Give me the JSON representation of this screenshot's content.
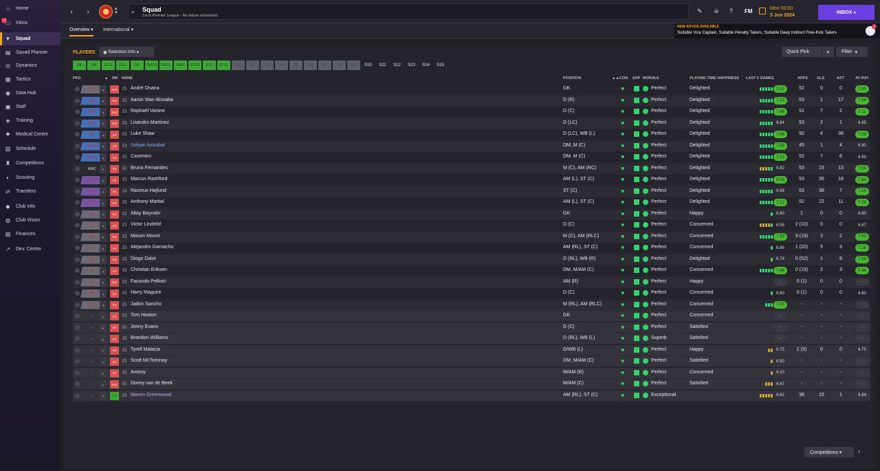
{
  "sidebar": {
    "inbox_badge": "13",
    "items": [
      {
        "label": "Home",
        "icon": "home-icon",
        "glyph": "⌂"
      },
      {
        "label": "Inbox",
        "icon": "inbox-icon",
        "glyph": "▭"
      },
      {
        "label": "Squad",
        "icon": "shirt-icon",
        "glyph": "▼",
        "active": true
      },
      {
        "label": "Squad Planner",
        "icon": "planner-icon",
        "glyph": "▤"
      },
      {
        "label": "Dynamics",
        "icon": "dynamics-icon",
        "glyph": "◎"
      },
      {
        "label": "Tactics",
        "icon": "tactics-icon",
        "glyph": "▦"
      },
      {
        "label": "Data Hub",
        "icon": "data-hub-icon",
        "glyph": "◉"
      },
      {
        "label": "Staff",
        "icon": "staff-icon",
        "glyph": "▣"
      },
      {
        "label": "Training",
        "icon": "training-icon",
        "glyph": "◈"
      },
      {
        "label": "Medical Centre",
        "icon": "medical-icon",
        "glyph": "✚"
      },
      {
        "label": "Schedule",
        "icon": "schedule-icon",
        "glyph": "▥"
      },
      {
        "label": "Competitions",
        "icon": "trophy-icon",
        "glyph": "♜"
      },
      {
        "label": "Scouting",
        "icon": "scouting-icon",
        "glyph": "◐"
      },
      {
        "label": "Transfers",
        "icon": "transfers-icon",
        "glyph": "⇄"
      },
      {
        "label": "Club Info",
        "icon": "shield-icon",
        "glyph": "◆"
      },
      {
        "label": "Club Vision",
        "icon": "vision-icon",
        "glyph": "◍"
      },
      {
        "label": "Finances",
        "icon": "finances-icon",
        "glyph": "▧"
      },
      {
        "label": "Dev. Centre",
        "icon": "dev-centre-icon",
        "glyph": "↗"
      }
    ]
  },
  "header": {
    "title": "Squad",
    "subtitle": "1st in Premier League - No fixture scheduled.",
    "fm": "FM",
    "time": "Mon 00:00",
    "date": "3 Jun 2024",
    "inbox_btn": "INBOX  »"
  },
  "tabs": [
    {
      "label": "Overview ▾"
    },
    {
      "label": "International ▾"
    }
  ],
  "advice": {
    "title": "NEW ADVICE AVAILABLE",
    "text": "Suitable Vice Captain, Suitable Penalty Takers, Suitable Deep Indirect Free-Kick Takers",
    "badge": "3"
  },
  "toolbar": {
    "players": "PLAYERS",
    "selection_info": "Selection Info",
    "quick_pick": "Quick Pick",
    "filter": "Filter"
  },
  "position_chips": [
    {
      "label": "GK",
      "s": "g"
    },
    {
      "label": "DR",
      "s": "g"
    },
    {
      "label": "DCR",
      "s": "g"
    },
    {
      "label": "DCL",
      "s": "g"
    },
    {
      "label": "DL",
      "s": "g"
    },
    {
      "label": "DMCR",
      "s": "g"
    },
    {
      "label": "DMCL",
      "s": "g"
    },
    {
      "label": "AMC",
      "s": "g"
    },
    {
      "label": "STCR",
      "s": "g"
    },
    {
      "label": "STC",
      "s": "g"
    },
    {
      "label": "STCL",
      "s": "g"
    },
    {
      "label": "S1",
      "s": "s"
    },
    {
      "label": "S2",
      "s": "s"
    },
    {
      "label": "S3",
      "s": "s"
    },
    {
      "label": "S4",
      "s": "s"
    },
    {
      "label": "S5",
      "s": "s"
    },
    {
      "label": "S6",
      "s": "s"
    },
    {
      "label": "S7",
      "s": "s"
    },
    {
      "label": "S8",
      "s": "s"
    },
    {
      "label": "S9",
      "s": "s"
    },
    {
      "label": "S10",
      "s": "t"
    },
    {
      "label": "S11",
      "s": "t"
    },
    {
      "label": "S12",
      "s": "t"
    },
    {
      "label": "S13",
      "s": "t"
    },
    {
      "label": "S14",
      "s": "t"
    },
    {
      "label": "S15",
      "s": "t"
    }
  ],
  "columns": {
    "pkd": "PKD",
    "inf": "INF",
    "name": "NAME",
    "position": "POSITION",
    "con": "CON",
    "shp": "SHP",
    "morale": "MORALE",
    "pth": "PLAYING TIME HAPPINESS",
    "l5": "LAST 5 GAMES",
    "apps": "APPS",
    "gls": "GLS",
    "ast": "AST",
    "avrat": "AV RAT"
  },
  "players": [
    {
      "role": "GK",
      "rc": "r-grey",
      "inf": "Hol",
      "ic": "red",
      "name": "André Onana",
      "nc": "",
      "pos": "GK",
      "morale": "Perfect",
      "pth": "Delighted",
      "l5": "ggggg",
      "rating": "7.12",
      "rs": "g",
      "apps": "52",
      "gls": "0",
      "ast": "0",
      "avr": "7.00",
      "as": "g"
    },
    {
      "role": "DR",
      "rc": "r-blue",
      "inf": "Hol",
      "ic": "red",
      "name": "Aaron Wan-Bissaka",
      "nc": "",
      "pos": "D (R)",
      "morale": "Perfect",
      "pth": "Delighted",
      "l5": "ggggg",
      "rating": "7.12",
      "rs": "g",
      "apps": "53",
      "gls": "1",
      "ast": "17",
      "avr": "7.04",
      "as": "g"
    },
    {
      "role": "DCR",
      "rc": "r-blue",
      "inf": "Hol",
      "ic": "red",
      "name": "Raphaël Varane",
      "nc": "",
      "pos": "D (C)",
      "morale": "Perfect",
      "pth": "Delighted",
      "l5": "ggggg",
      "rating": "7.48",
      "rs": "g",
      "apps": "51",
      "gls": "7",
      "ast": "2",
      "avr": "7.11",
      "as": "g"
    },
    {
      "role": "DCL",
      "rc": "r-blue",
      "inf": "Hol",
      "ic": "red",
      "name": "Lisandro Martínez",
      "nc": "",
      "pos": "D (LC)",
      "morale": "Perfect",
      "pth": "Delighted",
      "l5": "ggggg",
      "rating": "6.84",
      "rs": "n",
      "apps": "53",
      "gls": "2",
      "ast": "1",
      "avr": "6.85",
      "as": "n"
    },
    {
      "role": "DL",
      "rc": "r-blue",
      "inf": "Int",
      "ic": "red",
      "name": "Luke Shaw",
      "nc": "",
      "pos": "D (LC), WB (L)",
      "morale": "Perfect",
      "pth": "Delighted",
      "l5": "ggggg",
      "rating": "7.56",
      "rs": "g",
      "apps": "50",
      "gls": "4",
      "ast": "38",
      "avr": "7.09",
      "as": "g"
    },
    {
      "role": "DMCR",
      "rc": "r-blue",
      "inf": "Int",
      "ic": "red",
      "name": "Sofyan Amrabat",
      "nc": "blue",
      "pos": "DM, M (C)",
      "morale": "Perfect",
      "pth": "Delighted",
      "l5": "ggggg",
      "rating": "7.08",
      "rs": "g",
      "apps": "45",
      "gls": "1",
      "ast": "4",
      "avr": "6.90",
      "as": "n"
    },
    {
      "role": "DMCL",
      "rc": "r-blue",
      "inf": "Int",
      "ic": "red",
      "name": "Casemiro",
      "nc": "",
      "pos": "DM, M (C)",
      "morale": "Perfect",
      "pth": "Delighted",
      "l5": "ggggg",
      "rating": "7.12",
      "rs": "g",
      "apps": "52",
      "gls": "7",
      "ast": "6",
      "avr": "6.99",
      "as": "n"
    },
    {
      "role": "AMC",
      "rc": "r-none",
      "inf": "Int",
      "ic": "red",
      "name": "Bruno Fernandes",
      "nc": "",
      "pos": "M (C), AM (RC)",
      "morale": "Perfect",
      "pth": "Delighted",
      "l5": "yyygg",
      "rating": "6.82",
      "rs": "n",
      "apps": "53",
      "gls": "23",
      "ast": "13",
      "avr": "7.08",
      "as": "g"
    },
    {
      "role": "STCR",
      "rc": "r-purple",
      "inf": "Int",
      "ic": "red",
      "name": "Marcus Rashford",
      "nc": "",
      "pos": "AM (L), ST (C)",
      "morale": "Perfect",
      "pth": "Delighted",
      "l5": "ggggg",
      "rating": "8.08",
      "rs": "g",
      "apps": "53",
      "gls": "35",
      "ast": "18",
      "avr": "7.60",
      "as": "g"
    },
    {
      "role": "STC",
      "rc": "r-purple",
      "inf": "Int",
      "ic": "red",
      "name": "Rasmus Højlund",
      "nc": "",
      "pos": "ST (C)",
      "morale": "Perfect",
      "pth": "Delighted",
      "l5": "ggggg",
      "rating": "6.98",
      "rs": "n",
      "apps": "53",
      "gls": "38",
      "ast": "7",
      "avr": "7.29",
      "as": "g"
    },
    {
      "role": "STCL",
      "rc": "r-purple",
      "inf": "Int",
      "ic": "red",
      "name": "Anthony Martial",
      "nc": "",
      "pos": "AM (L), ST (C)",
      "morale": "Perfect",
      "pth": "Delighted",
      "l5": "ggggg",
      "rating": "7.22",
      "rs": "g",
      "apps": "52",
      "gls": "22",
      "ast": "11",
      "avr": "7.09",
      "as": "g"
    },
    {
      "role": "S1",
      "rc": "r-grey",
      "inf": "Int",
      "ic": "red",
      "name": "Altay Bayındır",
      "nc": "",
      "pos": "GK",
      "morale": "Perfect",
      "pth": "Happy",
      "l5": "g",
      "rating": "6.80",
      "rs": "n",
      "apps": "1",
      "gls": "0",
      "ast": "0",
      "avr": "6.80",
      "as": "n"
    },
    {
      "role": "S2",
      "rc": "r-grey",
      "inf": "Int",
      "ic": "red",
      "name": "Victor Lindelöf",
      "nc": "",
      "pos": "D (C)",
      "morale": "Perfect",
      "pth": "Concerned",
      "l5": "yyyyg",
      "rating": "6.58",
      "rs": "n",
      "apps": "2 (10)",
      "gls": "0",
      "ast": "0",
      "avr": "6.67",
      "as": "n"
    },
    {
      "role": "S3",
      "rc": "r-grey",
      "inf": "Int",
      "ic": "red",
      "name": "Mason Mount",
      "nc": "",
      "pos": "M (C), AM (RLC)",
      "morale": "Perfect",
      "pth": "Concerned",
      "l5": "ggggg",
      "rating": "7.30",
      "rs": "g",
      "apps": "9 (19)",
      "gls": "3",
      "ast": "2",
      "avr": "7.00",
      "as": "g"
    },
    {
      "role": "S4",
      "rc": "r-grey",
      "inf": "Int",
      "ic": "red",
      "name": "Alejandro Garnacho",
      "nc": "",
      "pos": "AM (RL), ST (C)",
      "morale": "Perfect",
      "pth": "Concerned",
      "l5": "g",
      "rating": "6.86",
      "rs": "n",
      "apps": "1 (20)",
      "gls": "5",
      "ast": "3",
      "avr": "7.28",
      "as": "g"
    },
    {
      "role": "S5",
      "rc": "r-grey",
      "inf": "Int",
      "ic": "red",
      "name": "Diogo Dalot",
      "nc": "",
      "pos": "D (RL), WB (R)",
      "morale": "Perfect",
      "pth": "Delighted",
      "l5": "g",
      "rating": "6.78",
      "rs": "n",
      "apps": "0 (52)",
      "gls": "1",
      "ast": "8",
      "avr": "7.03",
      "as": "g"
    },
    {
      "role": "S6",
      "rc": "r-grey",
      "inf": "Int",
      "ic": "red",
      "name": "Christian Eriksen",
      "nc": "",
      "pos": "DM, M/AM (C)",
      "morale": "Perfect",
      "pth": "Concerned",
      "l5": "ggggg",
      "rating": "7.46",
      "rs": "g",
      "apps": "0 (19)",
      "gls": "2",
      "ast": "3",
      "avr": "7.46",
      "as": "g"
    },
    {
      "role": "S7",
      "rc": "r-grey",
      "inf": "Hol",
      "ic": "red",
      "name": "Facundo Pellistri",
      "nc": "",
      "pos": "AM (R)",
      "morale": "Perfect",
      "pth": "Happy",
      "l5": "",
      "rating": "-",
      "rs": "d",
      "apps": "0 (1)",
      "gls": "0",
      "ast": "0",
      "avr": "-",
      "as": "d"
    },
    {
      "role": "S8",
      "rc": "r-grey",
      "inf": "Int",
      "ic": "red",
      "name": "Harry Maguire",
      "nc": "",
      "pos": "D (C)",
      "morale": "Perfect",
      "pth": "Concerned",
      "l5": "g",
      "rating": "6.80",
      "rs": "n",
      "apps": "0 (1)",
      "gls": "0",
      "ast": "0",
      "avr": "6.80",
      "as": "n"
    },
    {
      "role": "S9",
      "rc": "r-grey",
      "inf": "Int",
      "ic": "red",
      "name": "Jadon Sancho",
      "nc": "",
      "pos": "M (RL), AM (RLC)",
      "morale": "Perfect",
      "pth": "Concerned",
      "l5": "ggg",
      "rating": "7.03",
      "rs": "g",
      "apps": "-",
      "gls": "-",
      "ast": "-",
      "avr": "-",
      "as": "d"
    },
    {
      "role": "-",
      "rc": "r-none",
      "inf": "Int",
      "ic": "red",
      "name": "Tom Heaton",
      "nc": "",
      "pos": "GK",
      "morale": "Perfect",
      "pth": "Concerned",
      "l5": "",
      "rating": "-",
      "rs": "d",
      "apps": "-",
      "gls": "-",
      "ast": "-",
      "avr": "-",
      "as": "d"
    },
    {
      "role": "-",
      "rc": "r-none",
      "inf": "Int",
      "ic": "red",
      "name": "Jonny Evans",
      "nc": "",
      "pos": "D (C)",
      "morale": "Perfect",
      "pth": "Satisfied",
      "l5": "",
      "rating": "-",
      "rs": "d",
      "apps": "-",
      "gls": "-",
      "ast": "-",
      "avr": "-",
      "as": "d"
    },
    {
      "role": "-",
      "rc": "r-none",
      "inf": "Int",
      "ic": "red",
      "name": "Brandon Williams",
      "nc": "",
      "pos": "D (RL), WB (L)",
      "morale": "Superb",
      "pth": "Satisfied",
      "l5": "",
      "rating": "-",
      "rs": "d",
      "apps": "-",
      "gls": "-",
      "ast": "-",
      "avr": "-",
      "as": "d"
    },
    {
      "role": "-",
      "rc": "r-none",
      "inf": "Int",
      "ic": "red",
      "name": "Tyrell Malacia",
      "nc": "",
      "pos": "D/WB (L)",
      "morale": "Perfect",
      "pth": "Happy",
      "l5": "yy",
      "rating": "6.75",
      "rs": "n",
      "apps": "1 (5)",
      "gls": "0",
      "ast": "0",
      "avr": "6.75",
      "as": "n"
    },
    {
      "role": "-",
      "rc": "r-none",
      "inf": "Int",
      "ic": "red",
      "name": "Scott McTominay",
      "nc": "",
      "pos": "DM, M/AM (C)",
      "morale": "Perfect",
      "pth": "Satisfied",
      "l5": "y",
      "rating": "6.50",
      "rs": "n",
      "apps": "-",
      "gls": "-",
      "ast": "-",
      "avr": "-",
      "as": "d"
    },
    {
      "role": "-",
      "rc": "r-none",
      "inf": "Int",
      "ic": "red",
      "name": "Antony",
      "nc": "",
      "pos": "M/AM (R)",
      "morale": "Perfect",
      "pth": "Concerned",
      "l5": "y",
      "rating": "6.20",
      "rs": "n",
      "apps": "-",
      "gls": "-",
      "ast": "-",
      "avr": "-",
      "as": "d"
    },
    {
      "role": "-",
      "rc": "r-none",
      "inf": "Hol",
      "ic": "red",
      "name": "Donny van de Beek",
      "nc": "",
      "pos": "M/AM (C)",
      "morale": "Perfect",
      "pth": "Satisfied",
      "l5": "yyy",
      "rating": "6.47",
      "rs": "n",
      "apps": "-",
      "gls": "-",
      "ast": "-",
      "avr": "-",
      "as": "d"
    },
    {
      "role": "-",
      "rc": "r-none",
      "inf": "Fit",
      "ic": "green",
      "name": "Mason Greenwood",
      "nc": "purple",
      "pos": "AM (RL), ST (C)",
      "morale": "Exceptional",
      "pth": "",
      "l5": "yyyyy",
      "rating": "6.62",
      "rs": "n",
      "apps": "38",
      "gls": "15",
      "ast": "1",
      "avr": "6.84",
      "as": "n"
    }
  ],
  "footer": {
    "competitions": "Competitions ▾",
    "next": "›"
  }
}
